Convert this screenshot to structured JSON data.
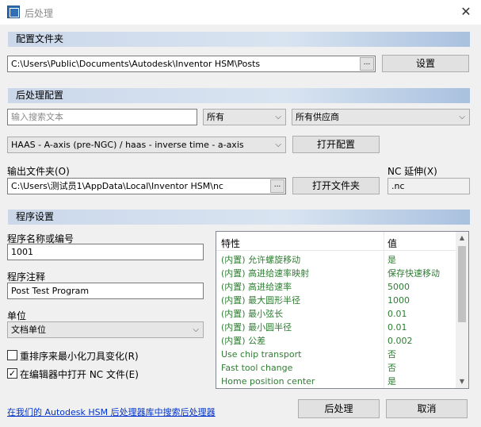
{
  "window": {
    "title": "后处理",
    "close": "✕"
  },
  "sections": {
    "config_folder": "配置文件夹",
    "post_config": "后处理配置",
    "program_settings": "程序设置"
  },
  "config_folder": {
    "path": "C:\\Users\\Public\\Documents\\Autodesk\\Inventor HSM\\Posts",
    "browse_label": "...",
    "setup_label": "设置"
  },
  "post_config": {
    "search_placeholder": "输入搜索文本",
    "filter_all": "所有",
    "vendor_all": "所有供应商",
    "selected_post": "HAAS - A-axis (pre-NGC) / haas - inverse time - a-axis",
    "open_config_label": "打开配置",
    "output_folder_label": "输出文件夹(O)",
    "output_folder_path": "C:\\Users\\测试员1\\AppData\\Local\\Inventor HSM\\nc",
    "browse_label": "...",
    "open_folder_label": "打开文件夹",
    "nc_ext_label": "NC 延伸(X)",
    "nc_ext_value": ".nc"
  },
  "program": {
    "name_label": "程序名称或编号",
    "name_value": "1001",
    "comment_label": "程序注释",
    "comment_value": "Post Test Program",
    "unit_label": "单位",
    "unit_value": "文档单位",
    "reorder_label": "重排序来最小化刀具变化(R)",
    "reorder_checked": false,
    "open_editor_label": "在编辑器中打开 NC 文件(E)",
    "open_editor_checked": true,
    "check_mark": "✓"
  },
  "properties": {
    "header_property": "特性",
    "header_value": "值",
    "rows": [
      {
        "name": "(内置) 允许螺旋移动",
        "value": "是"
      },
      {
        "name": "(内置) 高进给速率映射",
        "value": "保存快速移动"
      },
      {
        "name": "(内置) 高进给速率",
        "value": "5000"
      },
      {
        "name": "(内置) 最大圆形半径",
        "value": "1000"
      },
      {
        "name": "(内置) 最小弦长",
        "value": "0.01"
      },
      {
        "name": "(内置) 最小圆半径",
        "value": "0.01"
      },
      {
        "name": "(内置) 公差",
        "value": "0.002"
      },
      {
        "name": "Use chip transport",
        "value": "否"
      },
      {
        "name": "Fast tool change",
        "value": "否"
      },
      {
        "name": "Home position center",
        "value": "是"
      }
    ],
    "scroll_up": "▲",
    "scroll_down": "▼"
  },
  "footer": {
    "library_link": "在我们的 Autodesk HSM 后处理器库中搜索后处理器",
    "post_label": "后处理",
    "cancel_label": "取消"
  },
  "icons": {
    "dropdown": "chevron-down-icon",
    "app": "app-icon"
  }
}
